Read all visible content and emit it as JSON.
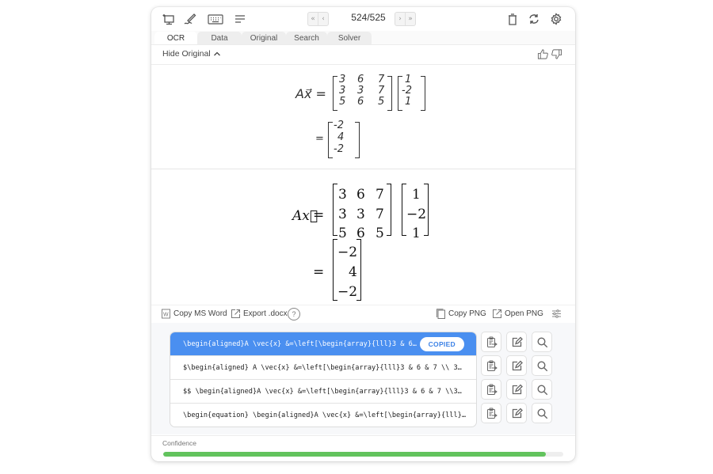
{
  "toolbar": {
    "icons": [
      "screen-capture-icon",
      "handwriting-pen-icon",
      "keyboard-icon",
      "text-lines-icon"
    ],
    "page_counter": "524/525",
    "nav": {
      "first": "«",
      "prev": "‹",
      "next": "›",
      "last": "»"
    },
    "right_icons": [
      "trash-icon",
      "refresh-icon",
      "settings-gear-icon"
    ]
  },
  "tabs": [
    {
      "label": "OCR",
      "active": true
    },
    {
      "label": "Data",
      "active": false
    },
    {
      "label": "Original",
      "active": false
    },
    {
      "label": "Search",
      "active": false
    },
    {
      "label": "Solver",
      "active": false
    }
  ],
  "hide_original": {
    "label": "Hide Original",
    "icon": "chevron-up-icon"
  },
  "feedback": {
    "thumbs_up": "thumbs-up-icon",
    "thumbs_down": "thumbs-down-icon"
  },
  "original_handwriting": {
    "lhs": "Ax⃗ =",
    "matrix": [
      [
        "3",
        "6",
        "7"
      ],
      [
        "3",
        "3",
        "7"
      ],
      [
        "5",
        "6",
        "5"
      ]
    ],
    "vector": [
      "1",
      "-2",
      "1"
    ],
    "eq2": "=",
    "result": [
      "-2",
      "4",
      "-2"
    ]
  },
  "rendered": {
    "lhs": "Ax⃗",
    "equals": "=",
    "matrix": [
      [
        "3",
        "6",
        "7"
      ],
      [
        "3",
        "3",
        "7"
      ],
      [
        "5",
        "6",
        "5"
      ]
    ],
    "vector": [
      "1",
      "−2",
      "1"
    ],
    "result": [
      "−2",
      "4",
      "−2"
    ]
  },
  "actions": {
    "copy_ms_word": "Copy MS Word",
    "export_docx": "Export .docx",
    "help": "?",
    "copy_png": "Copy PNG",
    "open_png": "Open PNG"
  },
  "latex_results": [
    {
      "text": "\\begin{aligned}A \\vec{x} &=\\left[\\begin{array}{lll}3 & 6…",
      "selected": true,
      "badge": "COPIED"
    },
    {
      "text": "$\\begin{aligned} A \\vec{x} &=\\left[\\begin{array}{lll}3 & 6 & 7 \\\\ 3…",
      "selected": false
    },
    {
      "text": "$$ \\begin{aligned}A \\vec{x} &=\\left[\\begin{array}{lll}3 & 6 & 7 \\\\3…",
      "selected": false
    },
    {
      "text": "\\begin{equation} \\begin{aligned}A \\vec{x} &=\\left[\\begin{array}{lll}…",
      "selected": false
    }
  ],
  "row_buttons": [
    "copy-to-clipboard-icon",
    "edit-icon",
    "search-icon"
  ],
  "confidence": {
    "label": "Confidence",
    "value": 0.956,
    "color": "#62c35d"
  },
  "colors": {
    "accent": "#4a8ff0",
    "copied_text": "#3c82e6"
  }
}
